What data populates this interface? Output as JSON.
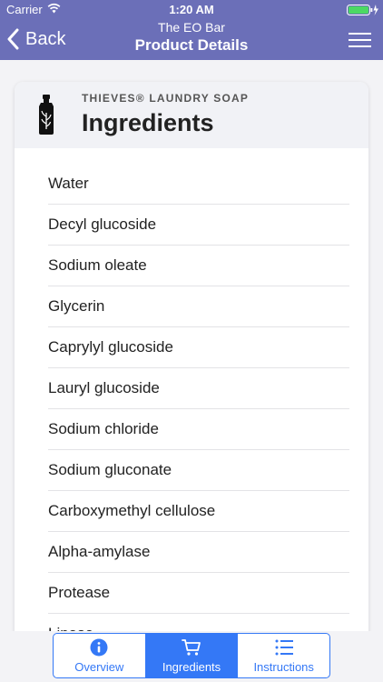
{
  "status_bar": {
    "carrier": "Carrier",
    "time": "1:20 AM"
  },
  "nav": {
    "back_label": "Back",
    "app_name": "The EO Bar",
    "title": "Product Details"
  },
  "card": {
    "subtitle": "THIEVES® LAUNDRY SOAP",
    "title": "Ingredients",
    "icon": "bottle-icon"
  },
  "ingredients": [
    "Water",
    "Decyl glucoside",
    "Sodium oleate",
    "Glycerin",
    "Caprylyl glucoside",
    "Lauryl glucoside",
    "Sodium chloride",
    "Sodium gluconate",
    "Carboxymethyl cellulose",
    "Alpha-amylase",
    "Protease",
    "Lipase"
  ],
  "tabs": [
    {
      "label": "Overview",
      "icon": "info-icon"
    },
    {
      "label": "Ingredients",
      "icon": "cart-icon",
      "active": true
    },
    {
      "label": "Instructions",
      "icon": "list-icon"
    }
  ],
  "colors": {
    "header": "#6b6fb8",
    "accent": "#3478f6"
  }
}
